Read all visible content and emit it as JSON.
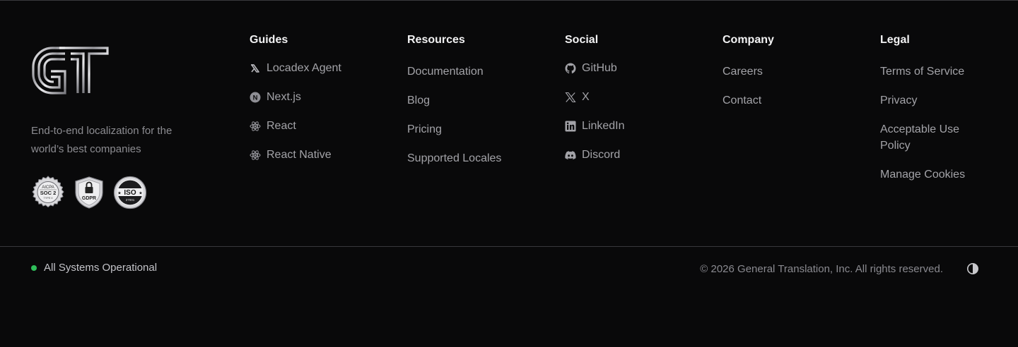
{
  "brand": {
    "logo_text": "GT",
    "tagline": "End-to-end localization for the world’s best companies",
    "badges": [
      {
        "icon": "soc2-badge-icon",
        "lines": [
          "AICPA",
          "SOC 2",
          "TYPE II"
        ]
      },
      {
        "icon": "gdpr-badge-icon",
        "lines": [
          "GDPR"
        ]
      },
      {
        "icon": "iso-badge-icon",
        "lines": [
          "ISO",
          "27001"
        ]
      }
    ]
  },
  "columns": {
    "guides": {
      "title": "Guides",
      "items": [
        {
          "label": "Locadex Agent",
          "icon": "locadex-icon"
        },
        {
          "label": "Next.js",
          "icon": "nextjs-icon"
        },
        {
          "label": "React",
          "icon": "react-icon"
        },
        {
          "label": "React Native",
          "icon": "react-icon"
        }
      ]
    },
    "resources": {
      "title": "Resources",
      "items": [
        "Documentation",
        "Blog",
        "Pricing",
        "Supported Locales"
      ]
    },
    "social": {
      "title": "Social",
      "items": [
        {
          "label": "GitHub",
          "icon": "github-icon"
        },
        {
          "label": "X",
          "icon": "x-icon"
        },
        {
          "label": "LinkedIn",
          "icon": "linkedin-icon"
        },
        {
          "label": "Discord",
          "icon": "discord-icon"
        }
      ]
    },
    "company": {
      "title": "Company",
      "items": [
        "Careers",
        "Contact"
      ]
    },
    "legal": {
      "title": "Legal",
      "items": [
        "Terms of Service",
        "Privacy",
        "Acceptable Use Policy",
        "Manage Cookies"
      ]
    }
  },
  "bottom": {
    "status": "All Systems Operational",
    "status_color": "#2fbe5a",
    "copyright": "© 2026 General Translation, Inc. All rights reserved.",
    "theme_toggle_icon": "contrast-icon"
  },
  "colors": {
    "background": "#09090a",
    "heading": "#f2f2f3",
    "link": "#a3a3a8",
    "muted": "#8c8c91"
  }
}
